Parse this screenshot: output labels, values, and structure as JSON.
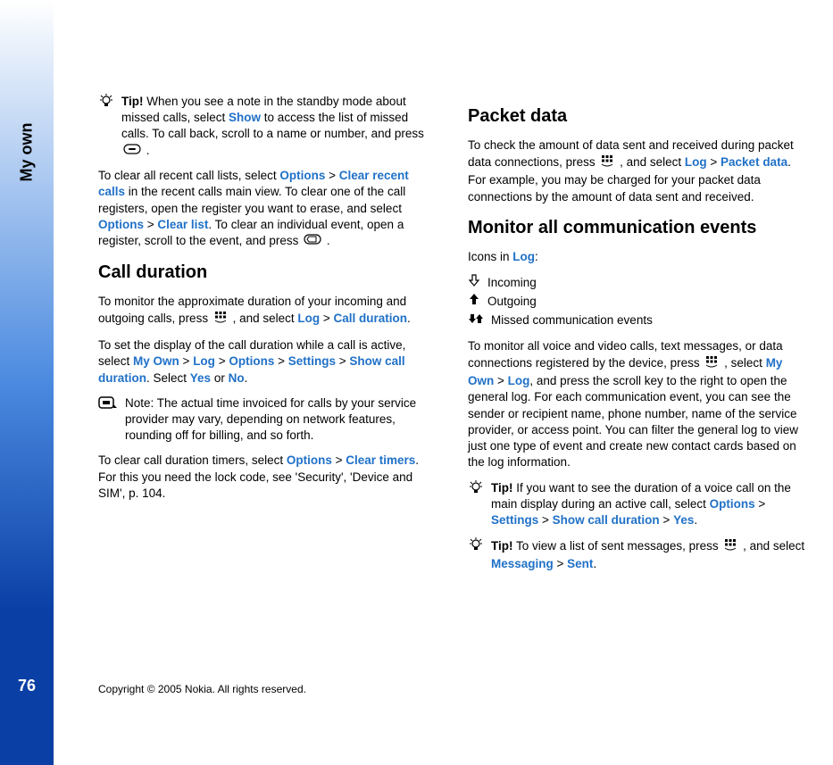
{
  "sidebar": {
    "label": "My own",
    "page": "76"
  },
  "copyright": "Copyright © 2005 Nokia. All rights reserved.",
  "left": {
    "tip1_label": "Tip!",
    "tip1_a": " When you see a note in the standby mode about missed calls, select ",
    "tip1_show": "Show",
    "tip1_b": " to access the list of missed calls. To call back, scroll to a name or number, and press ",
    "tip1_c": " .",
    "p1_a": "To clear all recent call lists, select ",
    "p1_opt1": "Options",
    "p1_gt1": " > ",
    "p1_clear_recent": "Clear recent calls",
    "p1_b": " in the recent calls main view. To clear one of the call registers, open the register you want to erase, and select ",
    "p1_opt2": "Options",
    "p1_gt2": " > ",
    "p1_clear_list": "Clear list",
    "p1_c": ". To clear an individual event, open a register, scroll to the event, and press ",
    "p1_d": " .",
    "h_call_duration": "Call duration",
    "p2_a": "To monitor the approximate duration of your incoming and outgoing calls, press ",
    "p2_b": " , and select ",
    "p2_log": "Log",
    "p2_gt": " > ",
    "p2_cd": "Call duration",
    "p2_c": ".",
    "p3_a": "To set the display of the call duration while a call is active, select ",
    "p3_myown": "My Own",
    "p3_gt1": " > ",
    "p3_log": "Log",
    "p3_gt2": " > ",
    "p3_options": "Options",
    "p3_gt3": " > ",
    "p3_settings": "Settings",
    "p3_gt4": " > ",
    "p3_showcd": "Show call duration",
    "p3_b": ". Select ",
    "p3_yes": "Yes",
    "p3_or": " or ",
    "p3_no": "No",
    "p3_c": ".",
    "note1": "Note: The actual time invoiced for calls by your service provider may vary, depending on network features, rounding off for billing, and so forth.",
    "p4_a": "To clear call duration timers, select ",
    "p4_options": "Options",
    "p4_gt": " > ",
    "p4_clear_timers": "Clear timers",
    "p4_b": ". For this you need the lock code, see 'Security', 'Device and SIM', p. 104."
  },
  "right": {
    "h_packet": "Packet data",
    "p1_a": "To check the amount of data sent and received during packet data connections, press ",
    "p1_b": " , and select ",
    "p1_log": "Log",
    "p1_gt": " > ",
    "p1_packet": "Packet data",
    "p1_c": ". For example, you may be charged for your packet data connections by the amount of data sent and received.",
    "h_monitor": "Monitor all communication events",
    "icons_in": "Icons in ",
    "icons_log": "Log",
    "icons_colon": ":",
    "incoming": "Incoming",
    "outgoing": "Outgoing",
    "missed": "Missed communication events",
    "p2_a": "To monitor all voice and video calls, text messages, or data connections registered by the device, press ",
    "p2_b": " , select ",
    "p2_myown": "My Own",
    "p2_gt": " > ",
    "p2_log": "Log",
    "p2_c": ", and press the scroll key to the right to open the general log. For each communication event, you can see the sender or recipient name, phone number, name of the service provider, or access point. You can filter the general log to view just one type of event and create new contact cards based on the log information.",
    "tip2_label": "Tip!",
    "tip2_a": " If you want to see the duration of a voice call on the main display during an active call, select ",
    "tip2_options": "Options",
    "tip2_gt1": " > ",
    "tip2_settings": "Settings",
    "tip2_gt2": " > ",
    "tip2_showcd": "Show call duration",
    "tip2_gt3": " > ",
    "tip2_yes": "Yes",
    "tip2_b": ".",
    "tip3_label": "Tip!",
    "tip3_a": " To view a list of sent messages, press ",
    "tip3_b": " , and select ",
    "tip3_messaging": "Messaging",
    "tip3_gt": " > ",
    "tip3_sent": "Sent",
    "tip3_c": "."
  }
}
